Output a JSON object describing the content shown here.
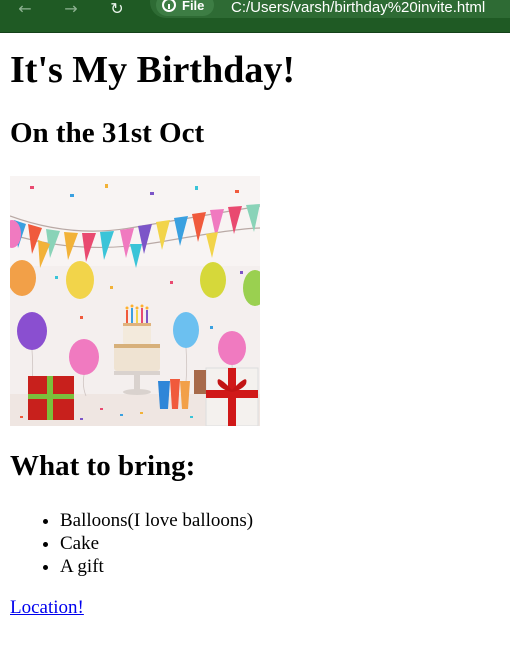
{
  "browser": {
    "back_icon": "←",
    "forward_icon": "→",
    "reload_icon": "↻",
    "site_chip_label": "File",
    "url": "C:/Users/varsh/birthday%20invite.html"
  },
  "page": {
    "title": "It's My Birthday!",
    "date_heading": "On the 31st Oct",
    "bring_heading": "What to bring:",
    "bring_items": [
      "Balloons(I love balloons)",
      "Cake",
      "A gift"
    ],
    "location_link": "Location!"
  },
  "colors": {
    "browser_bar": "#1f5a24",
    "link": "#0000ee"
  }
}
